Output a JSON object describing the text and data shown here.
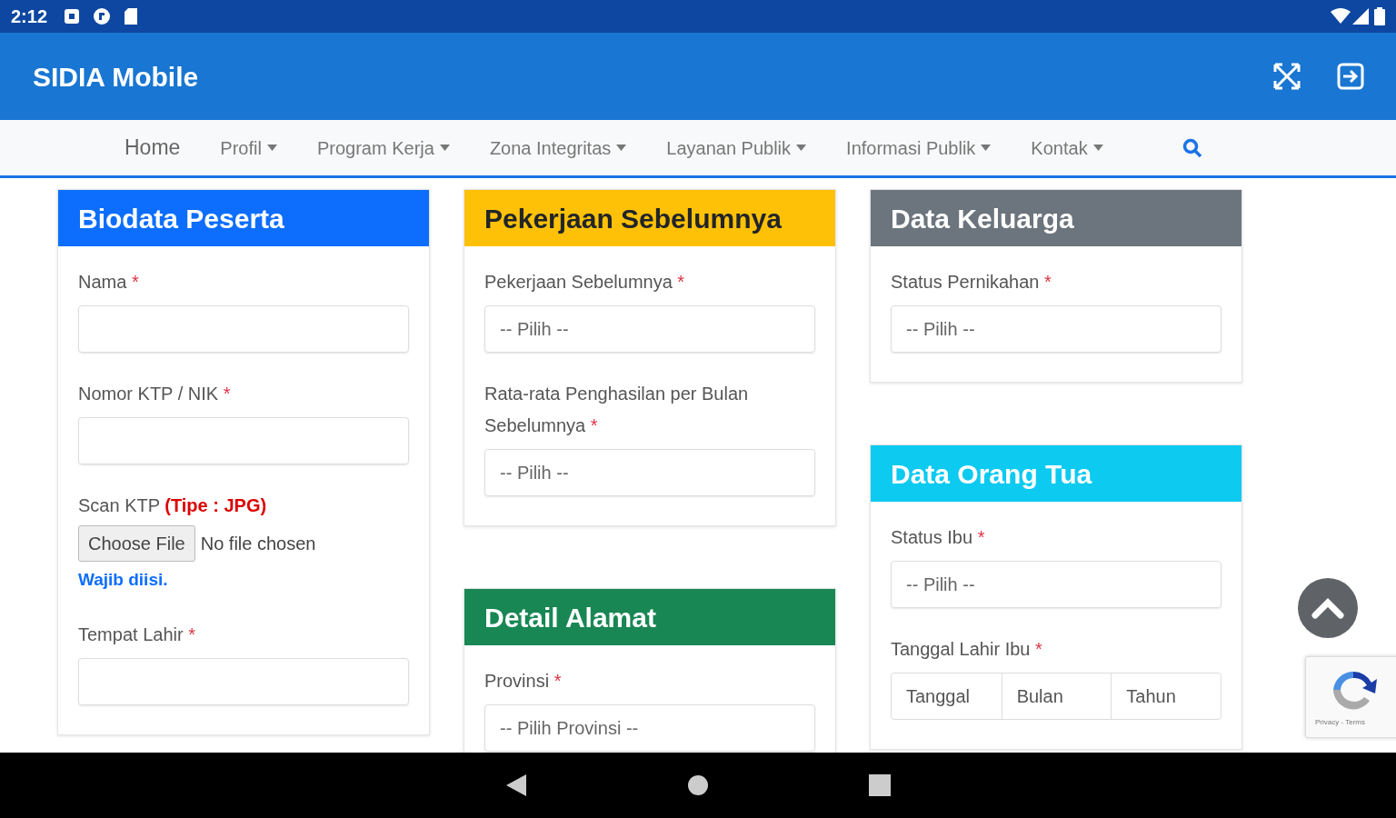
{
  "status_bar": {
    "time": "2:12"
  },
  "app_bar": {
    "title": "SIDIA Mobile"
  },
  "nav": [
    {
      "label": "Home",
      "dropdown": false
    },
    {
      "label": "Profil",
      "dropdown": true
    },
    {
      "label": "Program Kerja",
      "dropdown": true
    },
    {
      "label": "Zona Integritas",
      "dropdown": true
    },
    {
      "label": "Layanan Publik",
      "dropdown": true
    },
    {
      "label": "Informasi Publik",
      "dropdown": true
    },
    {
      "label": "Kontak",
      "dropdown": true
    }
  ],
  "columns": [
    {
      "cards": [
        {
          "title": "Biodata Peserta",
          "color": "#0d6efd",
          "fields": [
            {
              "kind": "text",
              "label": "Nama",
              "required_mark": "*"
            },
            {
              "kind": "text",
              "label": "Nomor KTP / NIK",
              "required_mark": "*"
            },
            {
              "kind": "file",
              "label": "Scan KTP",
              "note": "(Tipe : JPG)",
              "button": "Choose File",
              "status": "No file chosen",
              "hint": "Wajib diisi."
            },
            {
              "kind": "text",
              "label": "Tempat Lahir",
              "required_mark": "*"
            }
          ]
        }
      ]
    },
    {
      "cards": [
        {
          "title": "Pekerjaan Sebelumnya",
          "color": "#ffc107",
          "fields": [
            {
              "kind": "select",
              "label": "Pekerjaan Sebelumnya",
              "required_mark": "*",
              "value": "-- Pilih --"
            },
            {
              "kind": "select",
              "label": "Rata-rata Penghasilan per Bulan Sebelumnya",
              "required_mark": "*",
              "value": "-- Pilih --"
            }
          ]
        },
        {
          "title": "Detail Alamat",
          "color": "#198754",
          "fields": [
            {
              "kind": "select",
              "label": "Provinsi",
              "required_mark": "*",
              "value": "-- Pilih Provinsi --"
            }
          ]
        }
      ]
    },
    {
      "cards": [
        {
          "title": "Data Keluarga",
          "color": "#6c757d",
          "fields": [
            {
              "kind": "select",
              "label": "Status Pernikahan",
              "required_mark": "*",
              "value": "-- Pilih --"
            }
          ]
        },
        {
          "title": "Data Orang Tua",
          "color": "#0dcaf0",
          "fields": [
            {
              "kind": "select",
              "label": "Status Ibu",
              "required_mark": "*",
              "value": "-- Pilih --"
            },
            {
              "kind": "date",
              "label": "Tanggal Lahir Ibu",
              "required_mark": "*",
              "parts": [
                "Tanggal",
                "Bulan",
                "Tahun"
              ]
            }
          ]
        }
      ]
    }
  ],
  "recaptcha": {
    "text": "Privacy - Terms"
  }
}
